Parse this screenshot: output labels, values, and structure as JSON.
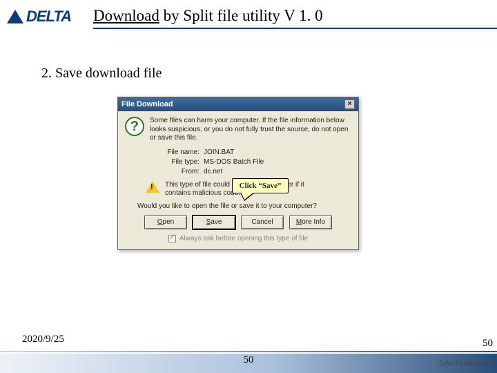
{
  "header": {
    "logo_text": "DELTA",
    "title_underlined": "Download",
    "title_rest": " by Split file utility V 1. 0"
  },
  "step": {
    "label": "2. Save download file"
  },
  "dialog": {
    "title": "File Download",
    "close_glyph": "×",
    "info_text": "Some files can harm your computer. If the file information below looks suspicious, or you do not fully trust the source, do not open or save this file.",
    "fields": {
      "name_label": "File name:",
      "name_value": "JOIN.BAT",
      "type_label": "File type:",
      "type_value": "MS-DOS Batch File",
      "from_label": "From:",
      "from_value": "dc.net"
    },
    "warn_text": "This type of file could harm your computer if it contains malicious code.",
    "callout": "Click “Save”",
    "prompt": "Would you like to open the file or save it to your computer?",
    "buttons": {
      "open": "Open",
      "save": "Save",
      "cancel": "Cancel",
      "more": "More Info"
    },
    "checkbox_label": "Always ask before opening this type of file"
  },
  "footer": {
    "date": "2020/9/25",
    "page": "50",
    "page2": "50",
    "confidential": "Delta Confidential"
  }
}
